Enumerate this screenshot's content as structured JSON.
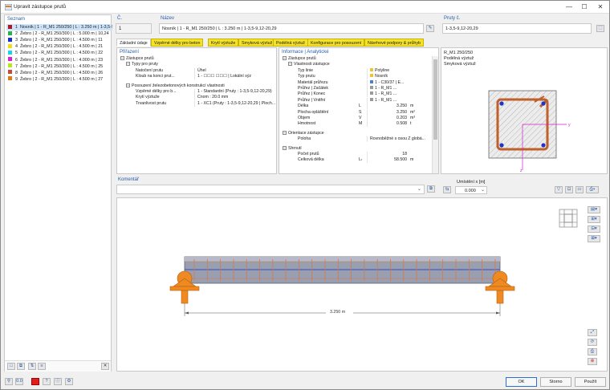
{
  "window": {
    "title": "Upravit zástupce prutů",
    "minimize": "—",
    "maximize": "☐",
    "close": "✕"
  },
  "list": {
    "header": "Seznam",
    "items": [
      {
        "num": "1",
        "text": "Nosník | 1 - R_M1 250/250 | L : 3.250 m | 1-3,5-9,12-20,29",
        "color": "#b0152a",
        "selected": true
      },
      {
        "num": "2",
        "text": "Žebro | 2 - R_M1 250/300 | L : 5.000 m | 10,24",
        "color": "#1db84b"
      },
      {
        "num": "3",
        "text": "Žebro | 2 - R_M1 250/300 | L : 4.500 m | 11",
        "color": "#1730c9"
      },
      {
        "num": "4",
        "text": "Žebro | 2 - R_M1 250/300 | L : 4.500 m | 21",
        "color": "#f2dd12"
      },
      {
        "num": "5",
        "text": "Žebro | 2 - R_M1 250/300 | L : 4.500 m | 22",
        "color": "#19d3e6"
      },
      {
        "num": "6",
        "text": "Žebro | 2 - R_M1 250/300 | L : 4.000 m | 23",
        "color": "#e419d3"
      },
      {
        "num": "7",
        "text": "Žebro | 2 - R_M1 250/300 | L : 4.500 m | 25",
        "color": "#b9e619"
      },
      {
        "num": "8",
        "text": "Žebro | 2 - R_M1 250/300 | L : 4.500 m | 26",
        "color": "#c44b3a"
      },
      {
        "num": "9",
        "text": "Žebro | 2 - R_M1 250/300 | L : 4.500 m | 27",
        "color": "#e07a13"
      }
    ]
  },
  "header_fields": {
    "num_label": "Č.",
    "num_value": "1",
    "name_label": "Název",
    "name_value": "Nosník | 1 - R_M1 250/250 | L : 3.250 m | 1-3,5-9,12-20,29",
    "members_label": "Pruty č.",
    "members_value": "1-3,5-9,12-20,29"
  },
  "tabs": [
    "Základní údaje",
    "Vzpěrné délky pro beton",
    "Krytí výztuže",
    "Smyková výztuž",
    "Podélná výztuž",
    "Konfigurace pro posouzení",
    "Návrhové podpory & průhyb"
  ],
  "assign": {
    "header": "Přiřazení",
    "rows": [
      {
        "type": "group",
        "text": "Zástupce prutů"
      },
      {
        "type": "group2",
        "text": "Typy pro pruty"
      },
      {
        "type": "kv",
        "key": "Natočení prutu",
        "val": "Úhel"
      },
      {
        "type": "kv",
        "key": "Kloub na konci prut...",
        "val": "1 - ☐☐☐ ☐☐☐ | Lokální sýz"
      },
      {
        "type": "sp"
      },
      {
        "type": "group2",
        "text": "Posouzení železobetonových konstrukcí vlastnosti"
      },
      {
        "type": "kv",
        "key": "Vzpěrné délky pro b...",
        "val": "1 - Standardní (Pruty : 1-3,5-9,12-20,29)"
      },
      {
        "type": "kv",
        "key": "Krytí výztuže",
        "val": "Cnom : 20.0 mm"
      },
      {
        "type": "kv",
        "key": "Trvanlivost prutu",
        "val": "1 - XC1 (Pruty : 1-3,5-9,12-20,29 | Ploch..."
      }
    ]
  },
  "info": {
    "header": "Informace | Analytické",
    "rows": [
      {
        "type": "group",
        "text": "Zástupce prutů"
      },
      {
        "type": "group2",
        "text": "Vlastnosti zástupce"
      },
      {
        "type": "kv",
        "key": "Typ linie",
        "val": "Polyline",
        "sq": "#f2c12e"
      },
      {
        "type": "kv",
        "key": "Typ prutu",
        "val": "Nosník",
        "sq": "#f2c12e"
      },
      {
        "type": "kv",
        "key": "Materiál průřezu",
        "val": "1 - C30/37 | E...",
        "sq": "#4a7fd1"
      },
      {
        "type": "kv",
        "key": "Průřez | Začátek",
        "val": "1 - R_M1 ...",
        "sq": "#999999"
      },
      {
        "type": "kv",
        "key": "Průřez | Konec",
        "val": "1 - R_M1 ...",
        "sq": "#999999"
      },
      {
        "type": "kv",
        "key": "Průřez | Vnitřní",
        "val": "1 - R_M1 ...",
        "sq": "#999999"
      },
      {
        "type": "kvs",
        "key": "Délka",
        "sym": "L",
        "val": "3.250",
        "unit": "m"
      },
      {
        "type": "kvs",
        "key": "Plocha opláštění",
        "sym": "S",
        "val": "3.250",
        "unit": "m²"
      },
      {
        "type": "kvs",
        "key": "Objem",
        "sym": "V",
        "val": "0.203",
        "unit": "m³"
      },
      {
        "type": "kvs",
        "key": "Hmotnost",
        "sym": "M",
        "val": "0.508",
        "unit": "t"
      },
      {
        "type": "sp"
      },
      {
        "type": "group",
        "text": "Orientace zástupce"
      },
      {
        "type": "kv",
        "key": "Poloha",
        "val": "Rovnoběžné s osou Z globá..."
      },
      {
        "type": "sp"
      },
      {
        "type": "group",
        "text": "Shrnutí"
      },
      {
        "type": "kvs",
        "key": "Počet prutů",
        "sym": "",
        "val": "18",
        "unit": ""
      },
      {
        "type": "kvs",
        "key": "Celková délka",
        "sym": "Lₜ",
        "val": "58.500",
        "unit": "m"
      }
    ]
  },
  "section": {
    "title": "R_M1 250/250",
    "line2": "Podélná výztuž",
    "line3": "Smyková výztuž",
    "location_label": "Umístění x [m]",
    "location_value": "0.000"
  },
  "comment": {
    "label": "Komentář",
    "value": ""
  },
  "model": {
    "dimension": "3.250 m"
  },
  "buttons": {
    "ok": "OK",
    "cancel": "Storno",
    "apply": "Použít"
  }
}
